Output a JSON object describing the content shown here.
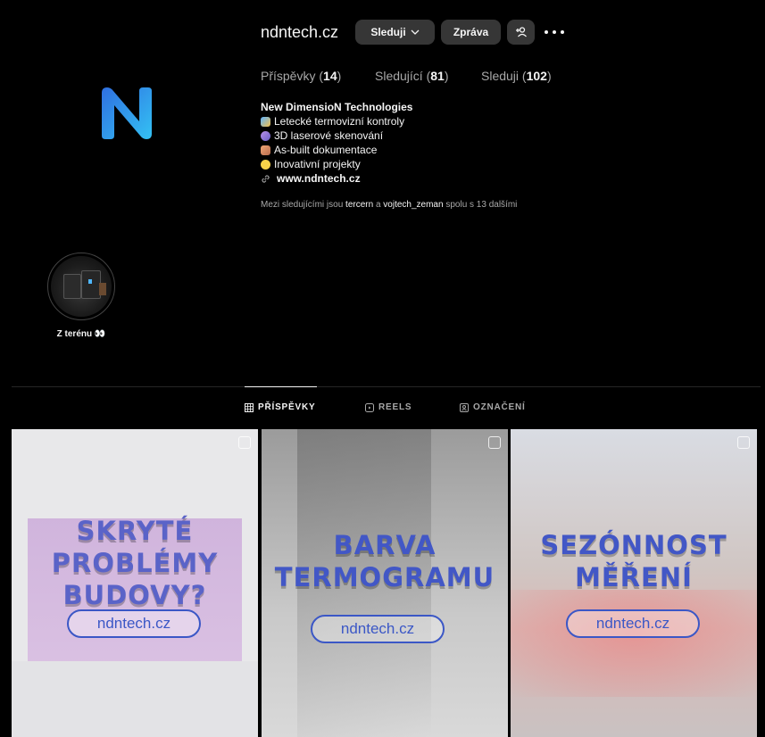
{
  "profile": {
    "username": "ndntech.cz",
    "follow_button": "Sleduji",
    "message_button": "Zpráva",
    "stats": {
      "posts_label": "Příspěvky",
      "posts_count": "14",
      "followers_label": "Sledující",
      "followers_count": "81",
      "following_label": "Sleduji",
      "following_count": "102"
    },
    "bio": {
      "name": "New DimensioN Technologies",
      "lines": [
        "Letecké termovizní kontroly",
        "3D laserové skenování",
        "As-built dokumentace",
        "Inovativní projekty"
      ],
      "link": "www.ndntech.cz"
    },
    "mutual": {
      "prefix": "Mezi sledujícími jsou",
      "user1": "tercern",
      "joiner": "a",
      "user2": "vojtech_zeman",
      "suffix": "spolu s 13 dalšími"
    }
  },
  "highlight": {
    "title": "Z terénu 👀"
  },
  "tabs": {
    "posts": "PŘÍSPĚVKY",
    "reels": "REELS",
    "tagged": "OZNAČENÍ"
  },
  "posts": [
    {
      "line1": "SKRYTÉ",
      "line2": "PROBLÉMY",
      "line3": "BUDOVY?",
      "pill": "ndntech.cz",
      "color": "#5a63c8"
    },
    {
      "line1": "BARVA",
      "line2": "TERMOGRAMU",
      "pill": "ndntech.cz",
      "color": "#4257c6"
    },
    {
      "line1": "SEZÓNNOST",
      "line2": "MĚŘENÍ",
      "pill": "ndntech.cz",
      "color": "#4257c6"
    }
  ],
  "colors": {
    "background": "#000000",
    "button": "#363636",
    "accent": "#3b57c6",
    "logo_blue": "#2aa7f0"
  }
}
